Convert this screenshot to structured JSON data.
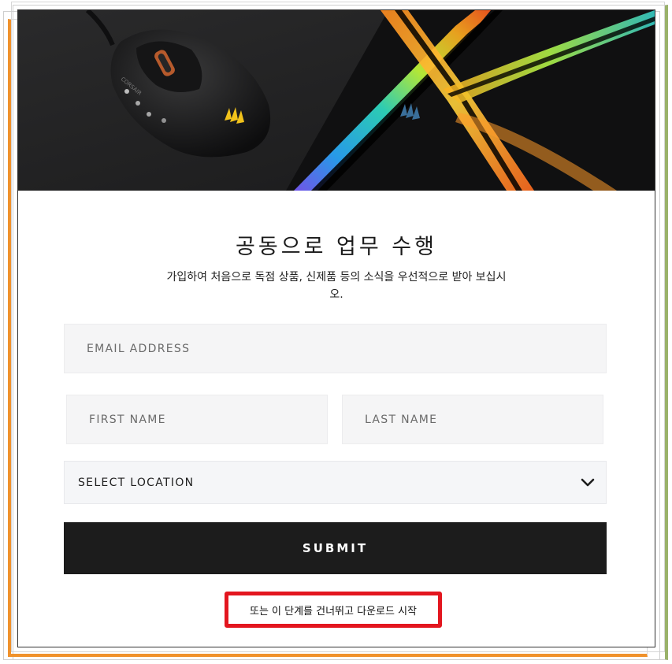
{
  "hero": {
    "image_name": "corsair-mouse-and-rgb-mousepad"
  },
  "form": {
    "title": "공동으로 업무 수행",
    "subtitle": "가입하여 처음으로 독점 상품, 신제품 등의 소식을 우선적으로 받아 보십시오.",
    "email_placeholder": "EMAIL ADDRESS",
    "first_name_placeholder": "FIRST NAME",
    "last_name_placeholder": "LAST NAME",
    "location_selected": "SELECT LOCATION",
    "submit_label": "SUBMIT",
    "skip_link": "또는 이 단계를 건너뛰고 다운로드 시작"
  },
  "colors": {
    "submit_bg": "#1c1c1c",
    "field_bg": "#f5f5f6",
    "highlight_border": "#e3161f",
    "frame_orange": "#f0922c",
    "frame_green": "#9ab26a"
  },
  "icons": {
    "select": "chevron-down-icon",
    "brand": "corsair-sails-icon"
  }
}
